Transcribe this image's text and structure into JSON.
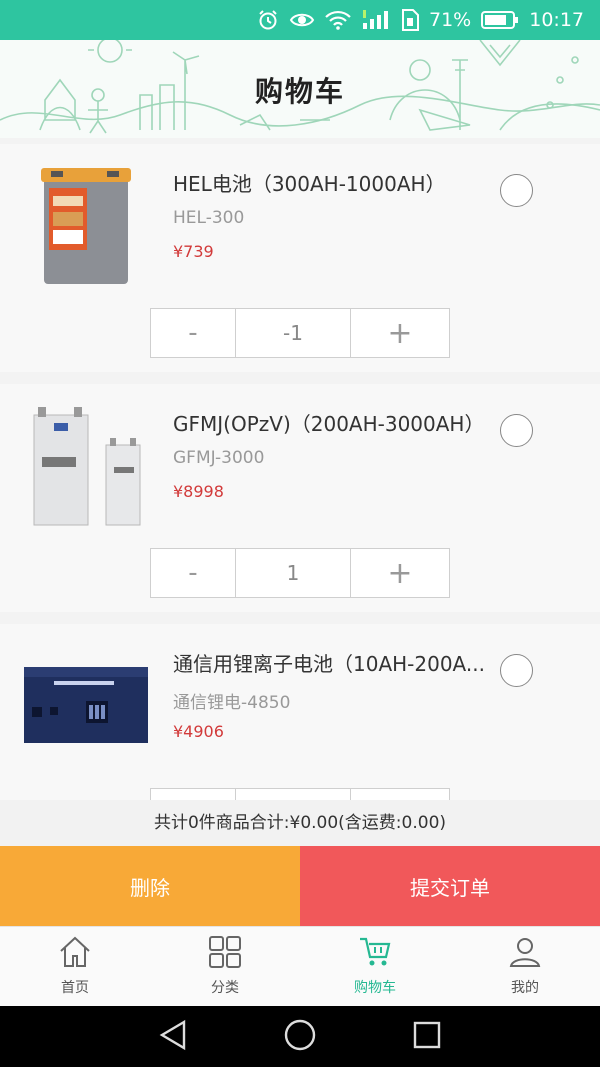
{
  "status_bar": {
    "battery_percent": "71%",
    "time": "10:17"
  },
  "header": {
    "title": "购物车"
  },
  "cart": {
    "items": [
      {
        "name": "HEL电池（300AH-1000AH）",
        "model": "HEL-300",
        "price": "¥739",
        "quantity": "-1",
        "minus": "-",
        "plus": "+"
      },
      {
        "name": "GFMJ(OPzV)（200AH-3000AH）",
        "model": "GFMJ-3000",
        "price": "¥8998",
        "quantity": "1",
        "minus": "-",
        "plus": "+"
      },
      {
        "name": "通信用锂离子电池（10AH-200A...",
        "model": "通信锂电-4850",
        "price": "¥4906",
        "quantity": "",
        "minus": "-",
        "plus": "+"
      }
    ]
  },
  "summary": {
    "text": "共计0件商品合计:¥0.00(含运费:0.00)"
  },
  "actions": {
    "delete_label": "删除",
    "submit_label": "提交订单"
  },
  "bottom_nav": {
    "items": [
      {
        "label": "首页",
        "icon": "home-icon"
      },
      {
        "label": "分类",
        "icon": "grid-icon"
      },
      {
        "label": "购物车",
        "icon": "cart-icon",
        "active": true
      },
      {
        "label": "我的",
        "icon": "user-icon"
      }
    ]
  },
  "colors": {
    "status_bar": "#2ec5a0",
    "accent": "#25b892",
    "price": "#d23a3a",
    "delete_button": "#f8a937",
    "submit_button": "#f1585a"
  }
}
